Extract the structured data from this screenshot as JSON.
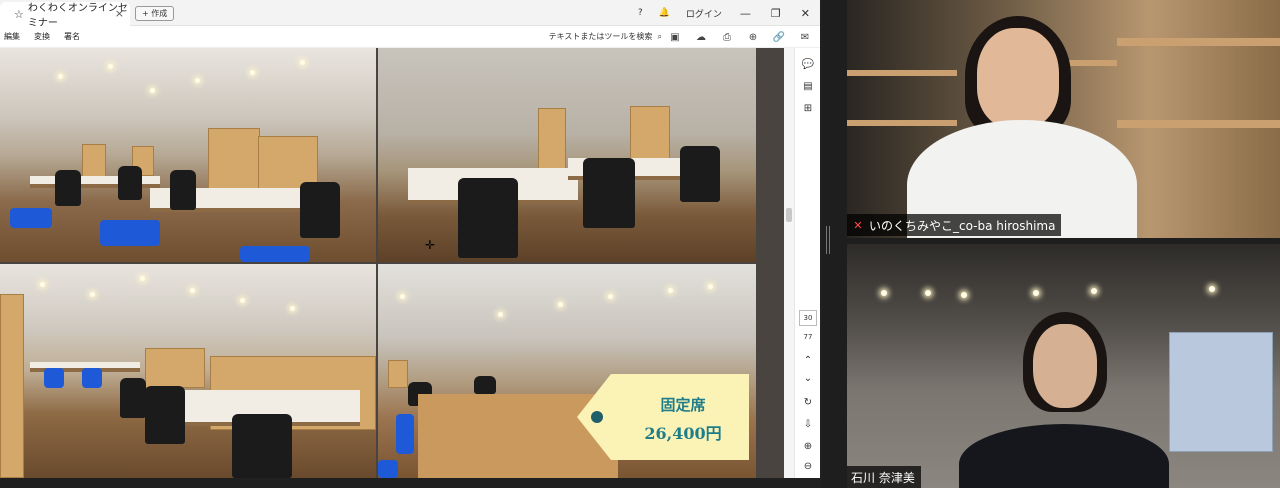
{
  "browser": {
    "tab_title": "わくわくオンラインセミナー",
    "tab_close": "×",
    "new_tab_label": "+ 作成",
    "login_label": "ログイン",
    "help_icon": "?",
    "bell_icon": "bell",
    "minimize_icon": "—",
    "restore_icon": "❐",
    "close_icon": "✕"
  },
  "menubar": {
    "items": [
      "編集",
      "変換",
      "署名"
    ],
    "search_tools_label": "テキストまたはツールを検索"
  },
  "document": {
    "price_tag": {
      "label": "固定席",
      "price": "26,400円",
      "color": "#1f7d8a",
      "bg_color": "#fbf2b6"
    }
  },
  "sidepanel": {
    "current_page": "30",
    "total_pages": "77"
  },
  "participants": [
    {
      "name": "いのくちみやこ_co-ba hiroshima",
      "muted": true
    },
    {
      "name": "石川 奈津美",
      "muted": false
    }
  ]
}
